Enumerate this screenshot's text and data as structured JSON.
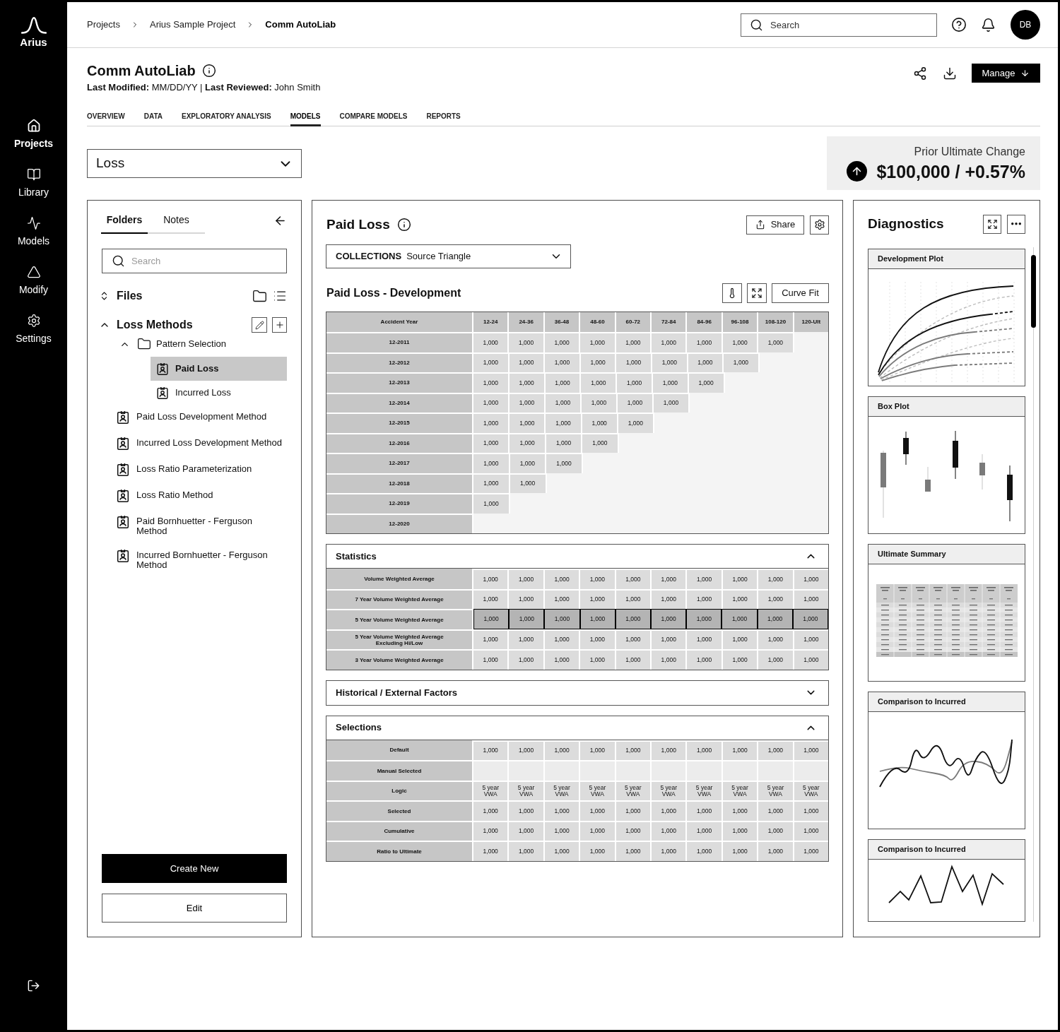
{
  "sidebar": {
    "logo": "Arius",
    "items": [
      {
        "label": "Projects",
        "selected": true
      },
      {
        "label": "Library",
        "selected": false
      },
      {
        "label": "Models",
        "selected": false
      },
      {
        "label": "Modify",
        "selected": false
      },
      {
        "label": "Settings",
        "selected": false
      }
    ]
  },
  "breadcrumb": [
    {
      "label": "Projects",
      "current": false
    },
    {
      "label": "Arius Sample Project",
      "current": false
    },
    {
      "label": "Comm AutoLiab",
      "current": true
    }
  ],
  "top_bar": {
    "search": {
      "placeholder": "Search"
    },
    "avatar": "DB"
  },
  "page_header": {
    "title": "Comm AutoLiab",
    "meta": "**Last Modified:** MM/DD/YY | **Last Reviewed:** John Smith",
    "manage_button": "Manage"
  },
  "tabs": [
    {
      "label": "OVERVIEW",
      "selected": false
    },
    {
      "label": "DATA",
      "selected": false
    },
    {
      "label": "EXPLORATORY ANALYSIS",
      "selected": false
    },
    {
      "label": "MODELS",
      "selected": true
    },
    {
      "label": "COMPARE MODELS",
      "selected": false
    },
    {
      "label": "REPORTS",
      "selected": false
    }
  ],
  "category_select": {
    "value": "Loss"
  },
  "prior_ultimate_change": {
    "label": "Prior Ultimate Change",
    "value": "$100,000 / +0.57%"
  },
  "folders_panel": {
    "tabs": [
      {
        "label": "Folders",
        "selected": true
      },
      {
        "label": "Notes",
        "selected": false
      }
    ],
    "search": {
      "placeholder": "Search"
    },
    "files": "Files",
    "tree": {
      "label": "Loss Methods",
      "expanded": true,
      "children": [
        {
          "label": "Pattern Selection",
          "kind": "folder",
          "expanded": true,
          "children": [
            {
              "label": "Paid Loss",
              "kind": "method",
              "selected": true
            },
            {
              "label": "Incurred Loss",
              "kind": "method",
              "selected": false
            }
          ]
        },
        {
          "label": "Paid Loss Development Method",
          "kind": "method",
          "selected": false
        },
        {
          "label": "Incurred Loss Development Method",
          "kind": "method",
          "selected": false
        },
        {
          "label": "Loss Ratio Parameterization",
          "kind": "method",
          "selected": false
        },
        {
          "label": "Loss Ratio Method",
          "kind": "method",
          "selected": false
        },
        {
          "label": "Paid Bornhuetter - Ferguson Method",
          "kind": "method",
          "selected": false
        },
        {
          "label": "Incurred Bornhuetter - Ferguson Method",
          "kind": "method",
          "selected": false
        }
      ]
    },
    "buttons": [
      {
        "label": "Create New",
        "kind": "primary"
      },
      {
        "label": "Edit",
        "kind": "secondary"
      }
    ]
  },
  "model_panel": {
    "title": "Paid Loss",
    "share_button": "Share",
    "collections": {
      "label": "COLLECTIONS",
      "value": "Source Triangle"
    },
    "development": {
      "title": "Paid Loss - Development",
      "curve_fit_button": "Curve Fit",
      "columns": [
        "Accident Year",
        "12-24",
        "24-36",
        "36-48",
        "48-60",
        "60-72",
        "72-84",
        "84-96",
        "96-108",
        "108-120",
        "120-Ult"
      ],
      "rows": [
        {
          "label": "12-2011",
          "values": [
            "1,000",
            "1,000",
            "1,000",
            "1,000",
            "1,000",
            "1,000",
            "1,000",
            "1,000",
            "1,000"
          ]
        },
        {
          "label": "12-2012",
          "values": [
            "1,000",
            "1,000",
            "1,000",
            "1,000",
            "1,000",
            "1,000",
            "1,000",
            "1,000"
          ]
        },
        {
          "label": "12-2013",
          "values": [
            "1,000",
            "1,000",
            "1,000",
            "1,000",
            "1,000",
            "1,000",
            "1,000"
          ]
        },
        {
          "label": "12-2014",
          "values": [
            "1,000",
            "1,000",
            "1,000",
            "1,000",
            "1,000",
            "1,000"
          ]
        },
        {
          "label": "12-2015",
          "values": [
            "1,000",
            "1,000",
            "1,000",
            "1,000",
            "1,000"
          ]
        },
        {
          "label": "12-2016",
          "values": [
            "1,000",
            "1,000",
            "1,000",
            "1,000"
          ]
        },
        {
          "label": "12-2017",
          "values": [
            "1,000",
            "1,000",
            "1,000"
          ]
        },
        {
          "label": "12-2018",
          "values": [
            "1,000",
            "1,000"
          ]
        },
        {
          "label": "12-2019",
          "values": [
            "1,000"
          ]
        },
        {
          "label": "12-2020"
        }
      ]
    },
    "sections": [
      {
        "title": "Statistics",
        "expanded": true,
        "rows": [
          {
            "label": "Volume Weighted Average",
            "selected": false,
            "values": [
              "1,000",
              "1,000",
              "1,000",
              "1,000",
              "1,000",
              "1,000",
              "1,000",
              "1,000",
              "1,000",
              "1,000"
            ]
          },
          {
            "label": "7 Year Volume Weighted Average",
            "selected": false,
            "values": [
              "1,000",
              "1,000",
              "1,000",
              "1,000",
              "1,000",
              "1,000",
              "1,000",
              "1,000",
              "1,000",
              "1,000"
            ]
          },
          {
            "label": "5 Year Volume Weighted Average",
            "selected": true,
            "values": [
              "1,000",
              "1,000",
              "1,000",
              "1,000",
              "1,000",
              "1,000",
              "1,000",
              "1,000",
              "1,000",
              "1,000"
            ]
          },
          {
            "label": "5 Year Volume Weighted Average Excluding Hi/Low",
            "selected": false,
            "values": [
              "1,000",
              "1,000",
              "1,000",
              "1,000",
              "1,000",
              "1,000",
              "1,000",
              "1,000",
              "1,000",
              "1,000"
            ]
          },
          {
            "label": "3 Year Volume Weighted Average",
            "selected": false,
            "values": [
              "1,000",
              "1,000",
              "1,000",
              "1,000",
              "1,000",
              "1,000",
              "1,000",
              "1,000",
              "1,000",
              "1,000"
            ]
          }
        ]
      },
      {
        "title": "Historical / External Factors",
        "expanded": false
      },
      {
        "title": "Selections",
        "expanded": true,
        "rows": [
          {
            "label": "Default",
            "kind": "values",
            "values": [
              "1,000",
              "1,000",
              "1,000",
              "1,000",
              "1,000",
              "1,000",
              "1,000",
              "1,000",
              "1,000",
              "1,000"
            ]
          },
          {
            "label": "Manual Selected",
            "kind": "input"
          },
          {
            "label": "Logic",
            "kind": "values",
            "values": [
              "5 year VWA",
              "5 year VWA",
              "5 year VWA",
              "5 year VWA",
              "5 year VWA",
              "5 year VWA",
              "5 year VWA",
              "5 year VWA",
              "5 year VWA",
              "5 year VWA"
            ]
          },
          {
            "label": "Selected",
            "kind": "values",
            "values": [
              "1,000",
              "1,000",
              "1,000",
              "1,000",
              "1,000",
              "1,000",
              "1,000",
              "1,000",
              "1,000",
              "1,000"
            ]
          },
          {
            "label": "Cumulative",
            "kind": "values",
            "values": [
              "1,000",
              "1,000",
              "1,000",
              "1,000",
              "1,000",
              "1,000",
              "1,000",
              "1,000",
              "1,000",
              "1,000"
            ]
          },
          {
            "label": "Ratio to Ultimate",
            "kind": "values",
            "values": [
              "1,000",
              "1,000",
              "1,000",
              "1,000",
              "1,000",
              "1,000",
              "1,000",
              "1,000",
              "1,000",
              "1,000"
            ]
          }
        ]
      }
    ]
  },
  "diagnostics": {
    "title": "Diagnostics",
    "cards": [
      {
        "title": "Development Plot",
        "kind": "development"
      },
      {
        "title": "Box Plot",
        "kind": "box"
      },
      {
        "title": "Ultimate Summary",
        "kind": "summary"
      },
      {
        "title": "Comparison to Incurred",
        "kind": "comparison"
      },
      {
        "title": "Comparison to Incurred",
        "kind": "spikes"
      }
    ]
  }
}
